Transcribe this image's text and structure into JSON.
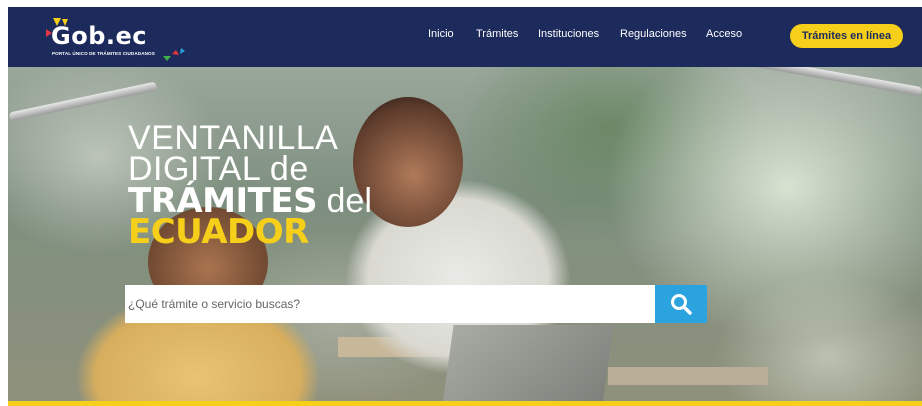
{
  "header": {
    "logo_text": "Gob.ec",
    "logo_subtitle": "PORTAL ÚNICO DE TRÁMITES CIUDADANOS",
    "nav": [
      {
        "label": "Inicio"
      },
      {
        "label": "Trámites"
      },
      {
        "label": "Instituciones"
      },
      {
        "label": "Regulaciones"
      },
      {
        "label": "Acceso"
      }
    ],
    "cta_label": "Trámites en línea"
  },
  "hero": {
    "headline_line1": "VENTANILLA",
    "headline_line2": "DIGITAL de",
    "headline_line3_bold": "TRÁMITES",
    "headline_line3_rest": " del",
    "headline_line4": "ECUADOR"
  },
  "search": {
    "placeholder": "¿Qué trámite o servicio buscas?",
    "value": ""
  },
  "colors": {
    "header_bg": "#1d2a5c",
    "accent_yellow": "#f5cf1a",
    "search_button": "#2aa3de"
  },
  "icons": {
    "search": "search-icon",
    "logo_arrows": "logo-arrows-icon"
  }
}
